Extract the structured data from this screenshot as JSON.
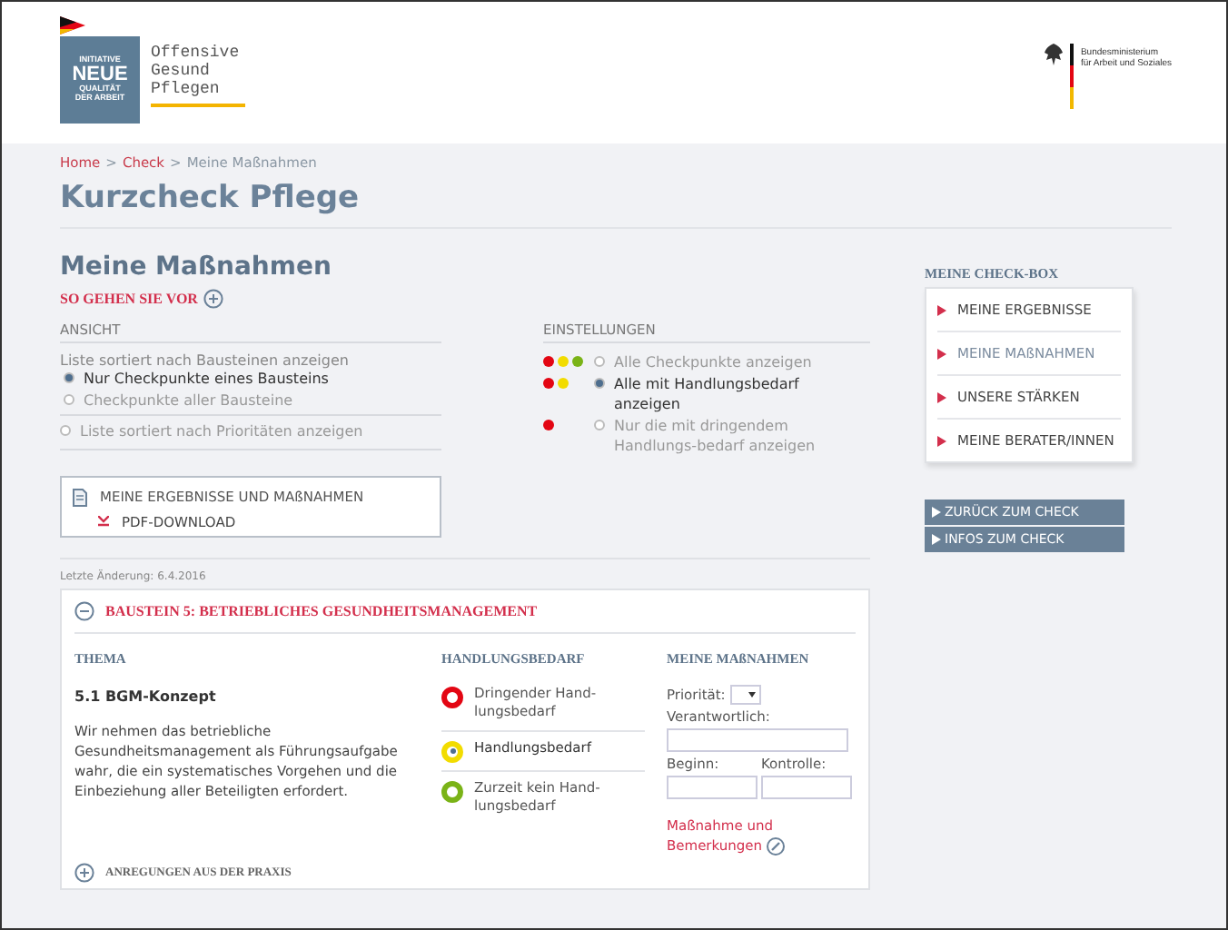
{
  "header": {
    "logo": {
      "initiative_lines": [
        "INITIATIVE",
        "NEUE",
        "QUALITÄT",
        "DER ARBEIT"
      ],
      "tagline_lines": [
        "Offensive",
        "Gesund",
        "Pflegen"
      ]
    },
    "ministry_lines": [
      "Bundesministerium",
      "für Arbeit und Soziales"
    ]
  },
  "breadcrumb": {
    "separator": ">",
    "items": [
      {
        "label": "Home",
        "selected": false
      },
      {
        "label": "Check",
        "selected": false
      },
      {
        "label": "Meine Maßnahmen",
        "selected": true
      }
    ]
  },
  "page_title": "Kurzcheck Pflege",
  "section_title": "Meine Maßnahmen",
  "how_to_link": "SO GEHEN SIE VOR",
  "ansicht": {
    "title": "ANSICHT",
    "subtitle": "Liste sortiert nach Bausteinen anzeigen",
    "options": [
      {
        "kind": "sub",
        "label": "Nur Checkpunkte eines Bausteins",
        "selected": true
      },
      {
        "kind": "sub",
        "label": "Checkpunkte aller Bausteine",
        "selected": false
      },
      {
        "kind": "main",
        "label": "Liste sortiert nach Prioritäten anzeigen",
        "selected": false
      }
    ]
  },
  "einstellungen": {
    "title": "EINSTELLUNGEN",
    "options": [
      {
        "dots": [
          {
            "color": "#e30613"
          },
          {
            "color": "#f2dc00"
          },
          {
            "color": "#7ab317"
          }
        ],
        "label": "Alle Checkpunkte anzeigen",
        "selected": false
      },
      {
        "dots": [
          {
            "color": "#e30613"
          },
          {
            "color": "#f2dc00"
          }
        ],
        "label": "Alle mit Handlungsbedarf anzeigen",
        "selected": true
      },
      {
        "dots": [
          {
            "color": "#e30613"
          }
        ],
        "label": "Nur die mit dringendem Handlungs-bedarf anzeigen",
        "selected": false
      }
    ]
  },
  "download_box": {
    "title": "MEINE ERGEBNISSE UND MAßNAHMEN",
    "link": "PDF-DOWNLOAD"
  },
  "last_change": "Letzte Änderung: 6.4.2016",
  "baustein": {
    "title": "BAUSTEIN 5: BETRIEBLICHES GESUNDHEITSMANAGEMENT",
    "expanded": true,
    "columns": [
      "THEMA",
      "HANDLUNGSBEDARF",
      "MEINE MAßNAHMEN"
    ],
    "topic_title": "5.1 BGM-Konzept",
    "topic_text": "Wir nehmen das betriebliche Gesundheitsmanagement als Führungsaufgabe wahr, die ein systematisches Vorgehen und die Einbeziehung aller Beteiligten erfordert.",
    "needs": [
      {
        "label": "Dringender Hand-lungsbedarf",
        "color": "#e30613",
        "selected": false
      },
      {
        "label": "Handlungsbedarf",
        "color": "#f2dc00",
        "selected": true
      },
      {
        "label": "Zurzeit kein Hand-lungsbedarf",
        "color": "#7ab317",
        "selected": false
      }
    ],
    "measures": {
      "priority_label": "Priorität:",
      "responsible_label": "Verantwortlich:",
      "start_label": "Beginn:",
      "control_label": "Kontrolle:",
      "notes_link": "Maßnahme und Bemerkungen"
    },
    "practice_link": "ANREGUNGEN AUS DER PRAXIS"
  },
  "checkbox": {
    "title": "MEINE CHECK-BOX",
    "items": [
      {
        "label": "MEINE ERGEBNISSE",
        "selected": false
      },
      {
        "label": "MEINE MAßNAHMEN",
        "selected": true
      },
      {
        "label": "UNSERE STÄRKEN",
        "selected": false
      },
      {
        "label": "MEINE BERATER/INNEN",
        "selected": false
      }
    ]
  },
  "buttons": [
    "ZURÜCK ZUM CHECK",
    "INFOS ZUM CHECK"
  ]
}
